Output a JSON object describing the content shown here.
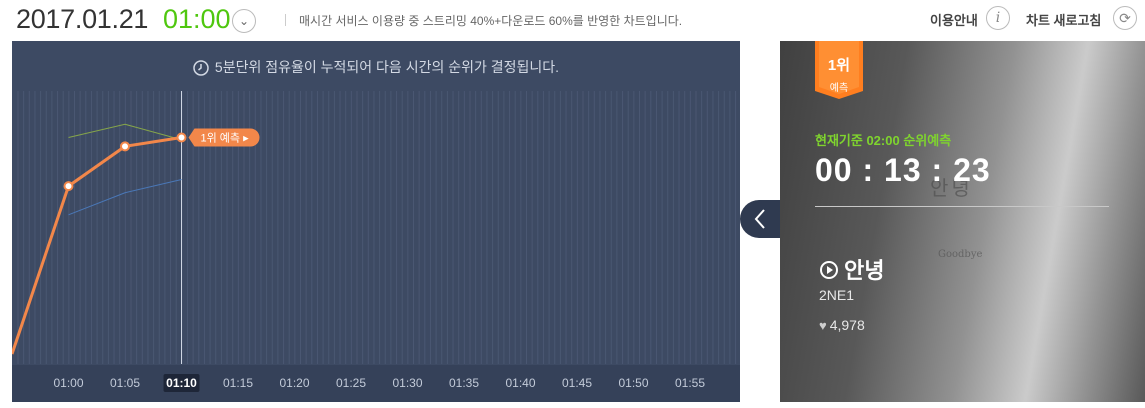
{
  "header": {
    "date": "2017.01.21",
    "time": "01:00",
    "description": "매시간 서비스 이용량 중 스트리밍 40%+다운로드 60%를 반영한 차트입니다.",
    "guide_label": "이용안내",
    "guide_icon": "info-icon",
    "refresh_label": "차트 새로고침",
    "refresh_icon": "refresh-icon"
  },
  "chart": {
    "notice": "5분단위 점유율이 누적되어 다음 시간의 순위가 결정됩니다.",
    "prediction_label": "1위 예측"
  },
  "chart_data": {
    "type": "line",
    "x": [
      "00:55",
      "01:00",
      "01:05",
      "01:10"
    ],
    "xlabels": [
      "01:00",
      "01:05",
      "01:10",
      "01:15",
      "01:20",
      "01:25",
      "01:30",
      "01:35",
      "01:40",
      "01:45",
      "01:50",
      "01:55"
    ],
    "current_tick": "01:10",
    "series": [
      {
        "values": [
          0.0,
          0.76,
          0.94,
          0.98
        ],
        "color": "#f2874a"
      },
      {
        "values": [
          null,
          0.98,
          1.04,
          0.97
        ],
        "color": "#86a64a"
      },
      {
        "values": [
          null,
          0.63,
          0.73,
          0.79
        ],
        "color": "#4a78b8"
      }
    ],
    "ylim": [
      0,
      1.1
    ]
  },
  "prediction": {
    "badge_rank": "1위",
    "badge_sub": "예측",
    "basis_prefix": "현재기준 ",
    "basis_time": "02:00",
    "basis_suffix": " 순위예측",
    "countdown": "00 : 13 : 23",
    "song_title": "안녕",
    "artist": "2NE1",
    "likes": "4,978",
    "album_art_title": "안녕",
    "album_art_english": "Goodbye"
  }
}
